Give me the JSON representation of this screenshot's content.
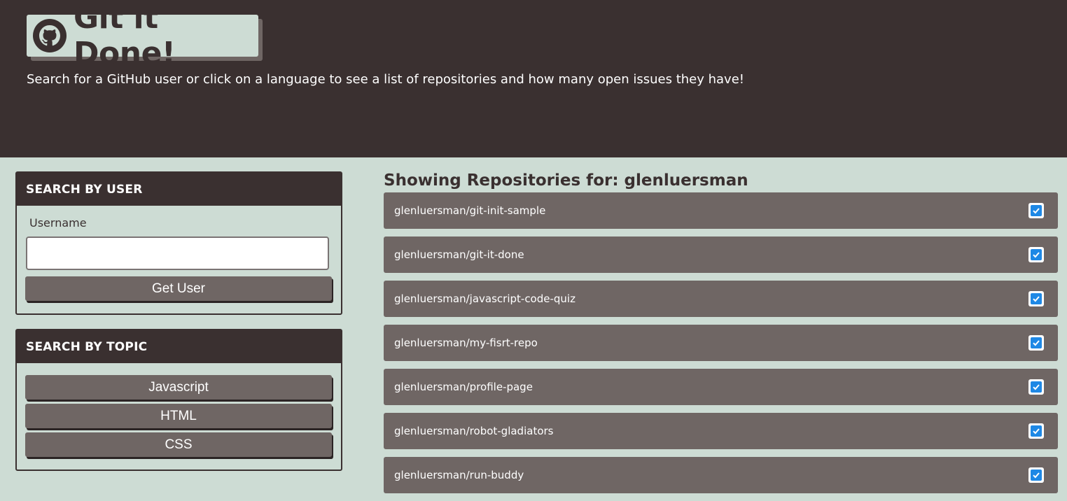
{
  "header": {
    "title": "Git it Done!",
    "subtitle": "Search for a GitHub user or click on a language to see a list of repositories and how many open issues they have!",
    "logo_icon": "github-icon"
  },
  "search_user": {
    "heading": "SEARCH BY USER",
    "label": "Username",
    "input_value": "",
    "button_label": "Get User"
  },
  "search_topic": {
    "heading": "SEARCH BY TOPIC",
    "topics": [
      "Javascript",
      "HTML",
      "CSS"
    ]
  },
  "repos": {
    "heading": "Showing Repositories for: glenluersman",
    "items": [
      {
        "name": "glenluersman/git-init-sample",
        "status_icon": "checkbox-checked-icon"
      },
      {
        "name": "glenluersman/git-it-done",
        "status_icon": "checkbox-checked-icon"
      },
      {
        "name": "glenluersman/javascript-code-quiz",
        "status_icon": "checkbox-checked-icon"
      },
      {
        "name": "glenluersman/my-fisrt-repo",
        "status_icon": "checkbox-checked-icon"
      },
      {
        "name": "glenluersman/profile-page",
        "status_icon": "checkbox-checked-icon"
      },
      {
        "name": "glenluersman/robot-gladiators",
        "status_icon": "checkbox-checked-icon"
      },
      {
        "name": "glenluersman/run-buddy",
        "status_icon": "checkbox-checked-icon"
      }
    ]
  },
  "colors": {
    "dark": "#3a3030",
    "light": "#cddcd4",
    "mid": "#6f6664",
    "check_blue": "#1e88e5"
  }
}
